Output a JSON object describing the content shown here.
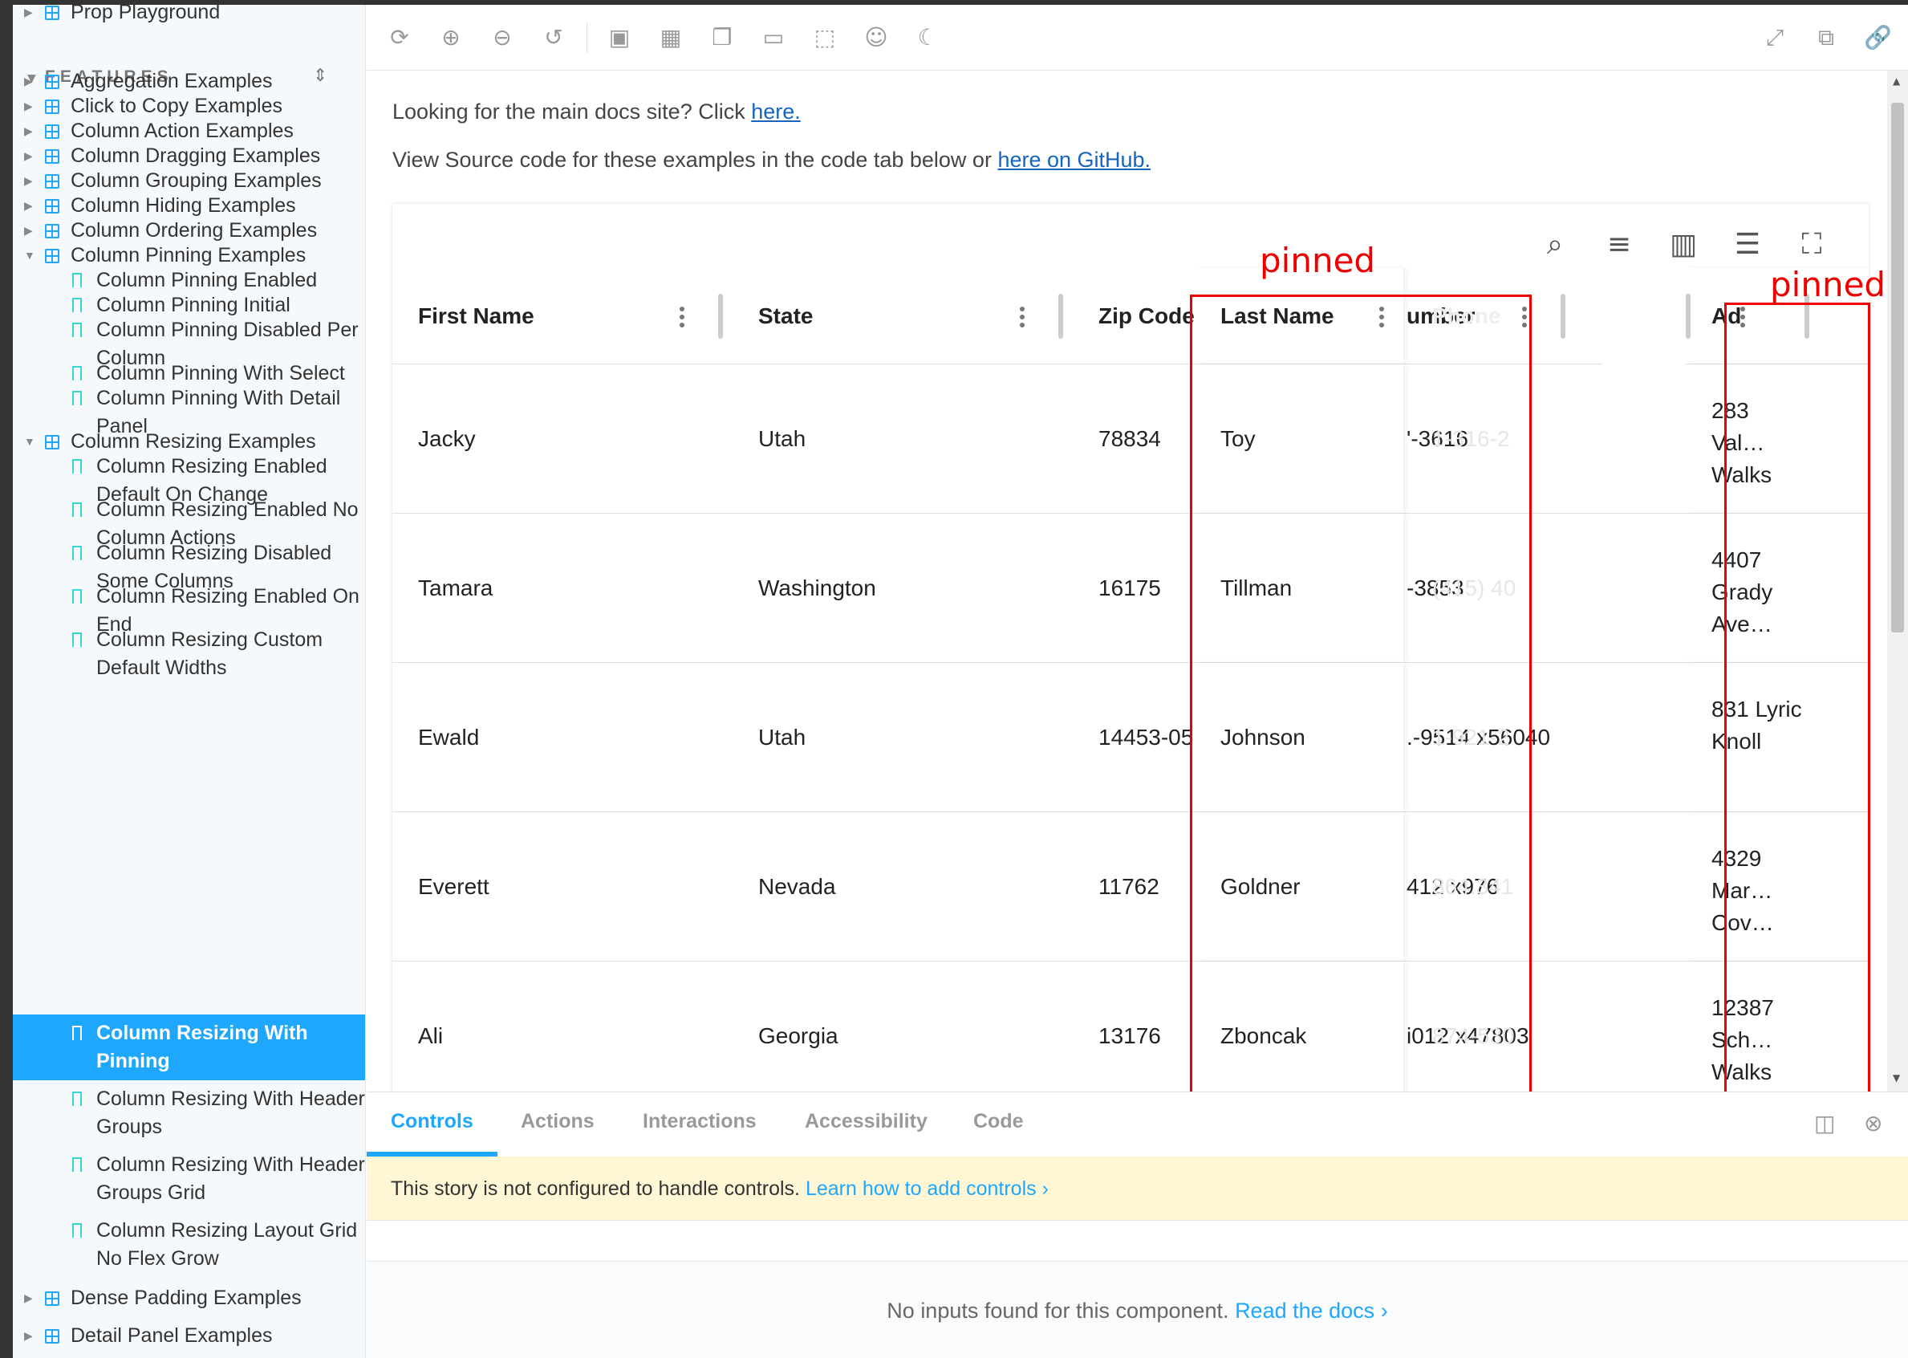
{
  "sidebar": {
    "top_item": "Prop Playground",
    "section_title": "FEATURES",
    "groups": [
      "Aggregation Examples",
      "Click to Copy Examples",
      "Column Action Examples",
      "Column Dragging Examples",
      "Column Grouping Examples",
      "Column Hiding Examples",
      "Column Ordering Examples",
      "Column Pinning Examples"
    ],
    "pinning_stories": [
      "Column Pinning Enabled",
      "Column Pinning Initial",
      "Column Pinning Disabled Per Column",
      "Column Pinning With Select",
      "Column Pinning With Detail Panel"
    ],
    "resizing_group": "Column Resizing Examples",
    "resizing_stories": [
      "Column Resizing Enabled Default On Change",
      "Column Resizing Enabled No Column Actions",
      "Column Resizing Disabled Some Columns",
      "Column Resizing Enabled On End",
      "Column Resizing Custom Default Widths",
      "Column Resizing With Pinning",
      "Column Resizing With Header Groups",
      "Column Resizing With Header Groups Grid",
      "Column Resizing Layout Grid No Flex Grow"
    ],
    "tail_groups": [
      "Dense Padding Examples",
      "Detail Panel Examples"
    ]
  },
  "intro": {
    "line1_text": "Looking for the main docs site? Click ",
    "line1_link": "here.",
    "line2_text": "View Source code for these examples in the code tab below or ",
    "line2_link": "here on GitHub."
  },
  "table": {
    "headers": {
      "first_name": "First Name",
      "state": "State",
      "zip": "Zip Code",
      "last_name": "Last Name",
      "phone_hidden": "Phone",
      "phone_visible": "umber",
      "address": "Ad"
    },
    "rows": [
      {
        "first": "Jacky",
        "state": "Utah",
        "zip": "78834",
        "last": "Toy",
        "phone_hidden": "1-316-2",
        "phone_visible": "'-3616",
        "address": "283 Val… Walks"
      },
      {
        "first": "Tamara",
        "state": "Washington",
        "zip": "16175",
        "last": "Tillman",
        "phone_hidden": "(415) 40",
        "phone_visible": "-3853",
        "address": "4407 Grady Ave…"
      },
      {
        "first": "Ewald",
        "state": "Utah",
        "zip": "14453-05",
        "last": "Johnson",
        "phone_hidden": "1-921-2",
        "phone_visible": ".-9514 x56040",
        "address": "831 Lyric Knoll"
      },
      {
        "first": "Everett",
        "state": "Nevada",
        "zip": "11762",
        "last": "Goldner",
        "phone_hidden": "864.341",
        "phone_visible": "412 x976",
        "address": "4329 Mar… Cov…"
      },
      {
        "first": "Ali",
        "state": "Georgia",
        "zip": "13176",
        "last": "Zboncak",
        "phone_hidden": "874-530",
        "phone_visible": "i012 x47803",
        "address": "12387 Sch… Walks"
      }
    ]
  },
  "annotations": {
    "pinned_1": "pinned",
    "pinned_2": "pinned"
  },
  "addons": {
    "tabs": [
      "Controls",
      "Actions",
      "Interactions",
      "Accessibility",
      "Code"
    ],
    "banner_text": "This story is not configured to handle controls. ",
    "banner_link": "Learn how to add controls",
    "noinputs_text": "No inputs found for this component. ",
    "noinputs_link": "Read the docs"
  },
  "colors": {
    "accent": "#1ea7fd",
    "annotation": "#ee0000",
    "banner_bg": "#fef6d5"
  }
}
